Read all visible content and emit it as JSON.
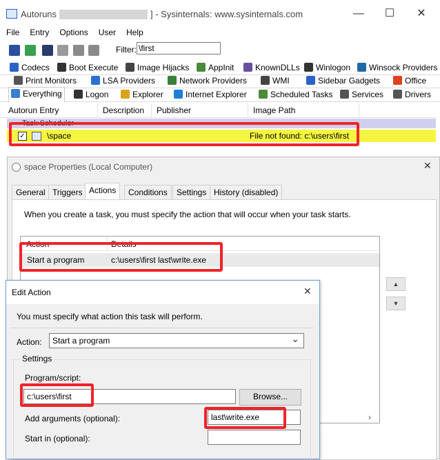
{
  "window": {
    "title_prefix": "Autoruns [",
    "title_suffix": "] - Sysinternals: www.sysinternals.com",
    "controls": {
      "minimize": "—",
      "maximize": "☐",
      "close": "✕"
    }
  },
  "menu": [
    "File",
    "Entry",
    "Options",
    "User",
    "Help"
  ],
  "toolbar": {
    "filter_label": "Filter:",
    "filter_value": "\\first"
  },
  "tabs_row1": [
    {
      "label": "Codecs",
      "icon": "codecs-icon",
      "color": "#2b62c8"
    },
    {
      "label": "Boot Execute",
      "icon": "boot-execute-icon",
      "color": "#333333"
    },
    {
      "label": "Image Hijacks",
      "icon": "image-hijacks-icon",
      "color": "#444444"
    },
    {
      "label": "AppInit",
      "icon": "appinit-icon",
      "color": "#4a8a3a"
    },
    {
      "label": "KnownDLLs",
      "icon": "knowndlls-icon",
      "color": "#6a4fa0"
    },
    {
      "label": "Winlogon",
      "icon": "winlogon-icon",
      "color": "#333333"
    },
    {
      "label": "Winsock Providers",
      "icon": "winsock-icon",
      "color": "#1f6aa5"
    }
  ],
  "tabs_row2": [
    {
      "label": "Print Monitors",
      "icon": "print-monitors-icon",
      "color": "#555555"
    },
    {
      "label": "LSA Providers",
      "icon": "lsa-providers-icon",
      "color": "#2d6fd1"
    },
    {
      "label": "Network Providers",
      "icon": "network-providers-icon",
      "color": "#3a7f3a"
    },
    {
      "label": "WMI",
      "icon": "wmi-icon",
      "color": "#444444"
    },
    {
      "label": "Sidebar Gadgets",
      "icon": "sidebar-gadgets-icon",
      "color": "#2b62c8"
    },
    {
      "label": "Office",
      "icon": "office-icon",
      "color": "#e0411f"
    }
  ],
  "tabs_row3": [
    {
      "label": "Everything",
      "icon": "everything-icon",
      "color": "#3a7fd0"
    },
    {
      "label": "Logon",
      "icon": "logon-icon",
      "color": "#333333"
    },
    {
      "label": "Explorer",
      "icon": "explorer-icon",
      "color": "#d9a21a"
    },
    {
      "label": "Internet Explorer",
      "icon": "internet-explorer-icon",
      "color": "#1f7fd6"
    },
    {
      "label": "Scheduled Tasks",
      "icon": "scheduled-tasks-icon",
      "color": "#4a8a3a"
    },
    {
      "label": "Services",
      "icon": "services-icon",
      "color": "#555555"
    },
    {
      "label": "Drivers",
      "icon": "drivers-icon",
      "color": "#555555"
    }
  ],
  "columns": [
    "Autorun Entry",
    "Description",
    "Publisher",
    "Image Path"
  ],
  "rows": {
    "group": "Task Scheduler",
    "entry": "\\space",
    "image_path": "File not found: c:\\users\\first"
  },
  "properties": {
    "title": "space Properties (Local Computer)",
    "close": "✕",
    "tabs": [
      "General",
      "Triggers",
      "Actions",
      "Conditions",
      "Settings",
      "History (disabled)"
    ],
    "instruction": "When you create a task, you must specify the action that will occur when your task starts.",
    "list_headers": [
      "Action",
      "Details"
    ],
    "action_row": {
      "action": "Start a program",
      "details": "c:\\users\\first last\\write.exe"
    },
    "scroll_up": "▲",
    "scroll_down": "▼",
    "scroll_right": "›"
  },
  "edit_action": {
    "title": "Edit Action",
    "close": "✕",
    "instruction": "You must specify what action this task will perform.",
    "action_label": "Action:",
    "action_value": "Start a program",
    "dropdown_arrow": "⌄",
    "settings_label": "Settings",
    "program_label": "Program/script:",
    "program_value": "c:\\users\\first",
    "browse_label": "Browse...",
    "arguments_label": "Add arguments (optional):",
    "arguments_value": "last\\write.exe",
    "start_in_label": "Start in (optional):",
    "start_in_value": ""
  },
  "colors": {
    "highlight_red": "#f0232a",
    "yellow_row": "#f5f541",
    "group_row": "#d0d0ee"
  }
}
